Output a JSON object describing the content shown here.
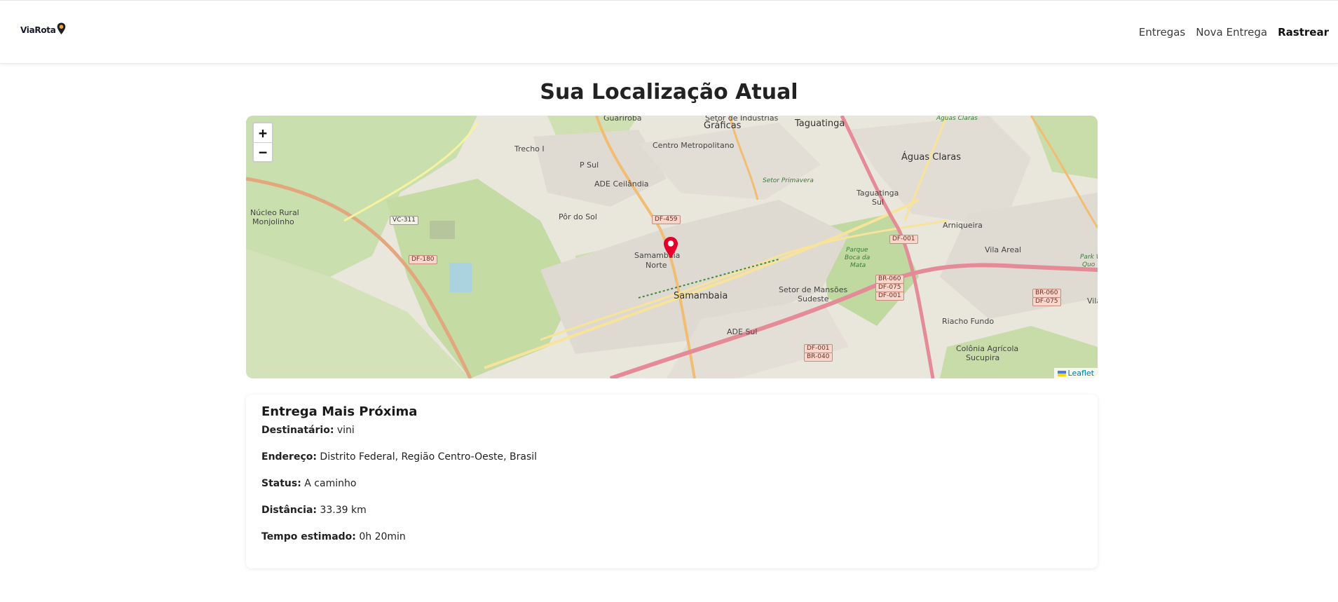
{
  "nav": {
    "brand": "ViaRota",
    "links": [
      "Entregas",
      "Nova Entrega",
      "Rastrear"
    ]
  },
  "page": {
    "title": "Sua Localização Atual"
  },
  "map": {
    "zoom_in": "+",
    "zoom_out": "−",
    "attribution": "Leaflet",
    "labels": {
      "guariroba": "Guariroba",
      "setor_industrias": "Setor de Indústrias",
      "graficas": "Gráficas",
      "taguatinga": "Taguatinga",
      "aguas_claras_small": "Águas Claras",
      "aguas_claras": "Águas Claras",
      "trecho_i": "Trecho I",
      "centro_metropolitano": "Centro Metropolitano",
      "p_sul": "P Sul",
      "ade_ceilandia": "ADE Ceilândia",
      "setor_primavera": "Setor Primavera",
      "taguatinga_sul_1": "Taguatinga",
      "taguatinga_sul_2": "Sul",
      "nucleo_rural_1": "Núcleo Rural",
      "nucleo_rural_2": "Monjolinho",
      "por_do_sol": "Pôr do Sol",
      "samambaia_norte_1": "Samambaia",
      "samambaia_norte_2": "Norte",
      "samambaia": "Samambaia",
      "arniqueira": "Arniqueira",
      "vila_areal": "Vila Areal",
      "parque_1": "Parque",
      "parque_2": "Boca da",
      "parque_3": "Mata",
      "setor_mansoes_1": "Setor de Mansões",
      "setor_mansoes_2": "Sudeste",
      "riacho_fundo": "Riacho Fundo",
      "ade_sul": "ADE Sul",
      "colonia_1": "Colônia Agrícola",
      "colonia_2": "Sucupira",
      "vila": "Vila",
      "park_way": "Park W",
      "quo": "Quo"
    },
    "shields": {
      "vc311_a": "VC-311",
      "vc311_b": "VC-311",
      "df180": "DF-180",
      "df459": "DF-459",
      "df001": "DF-001",
      "br060_a": "BR-060",
      "df075_a": "DF-075",
      "df001_b": "DF-001",
      "br060_b": "BR-060",
      "df075_b": "DF-075",
      "df001_c": "DF-001",
      "br040": "BR-040"
    }
  },
  "delivery": {
    "heading": "Entrega Mais Próxima",
    "rows": [
      {
        "label": "Destinatário:",
        "value": "vini"
      },
      {
        "label": "Endereço:",
        "value": "Distrito Federal, Região Centro-Oeste, Brasil"
      },
      {
        "label": "Status:",
        "value": "A caminho"
      },
      {
        "label": "Distância:",
        "value": "33.39 km"
      },
      {
        "label": "Tempo estimado:",
        "value": "0h 20min"
      }
    ]
  },
  "colors": {
    "marker": "#e4002b",
    "leaflet_link": "#0078a8",
    "map_background": "#e8e6dd",
    "forest": "#c6dba5",
    "urban": "#e0dcd3"
  },
  "icons": {
    "brand_pin": "map-pin-icon",
    "marker": "map-marker-icon",
    "flag": "ukraine-flag-icon"
  }
}
